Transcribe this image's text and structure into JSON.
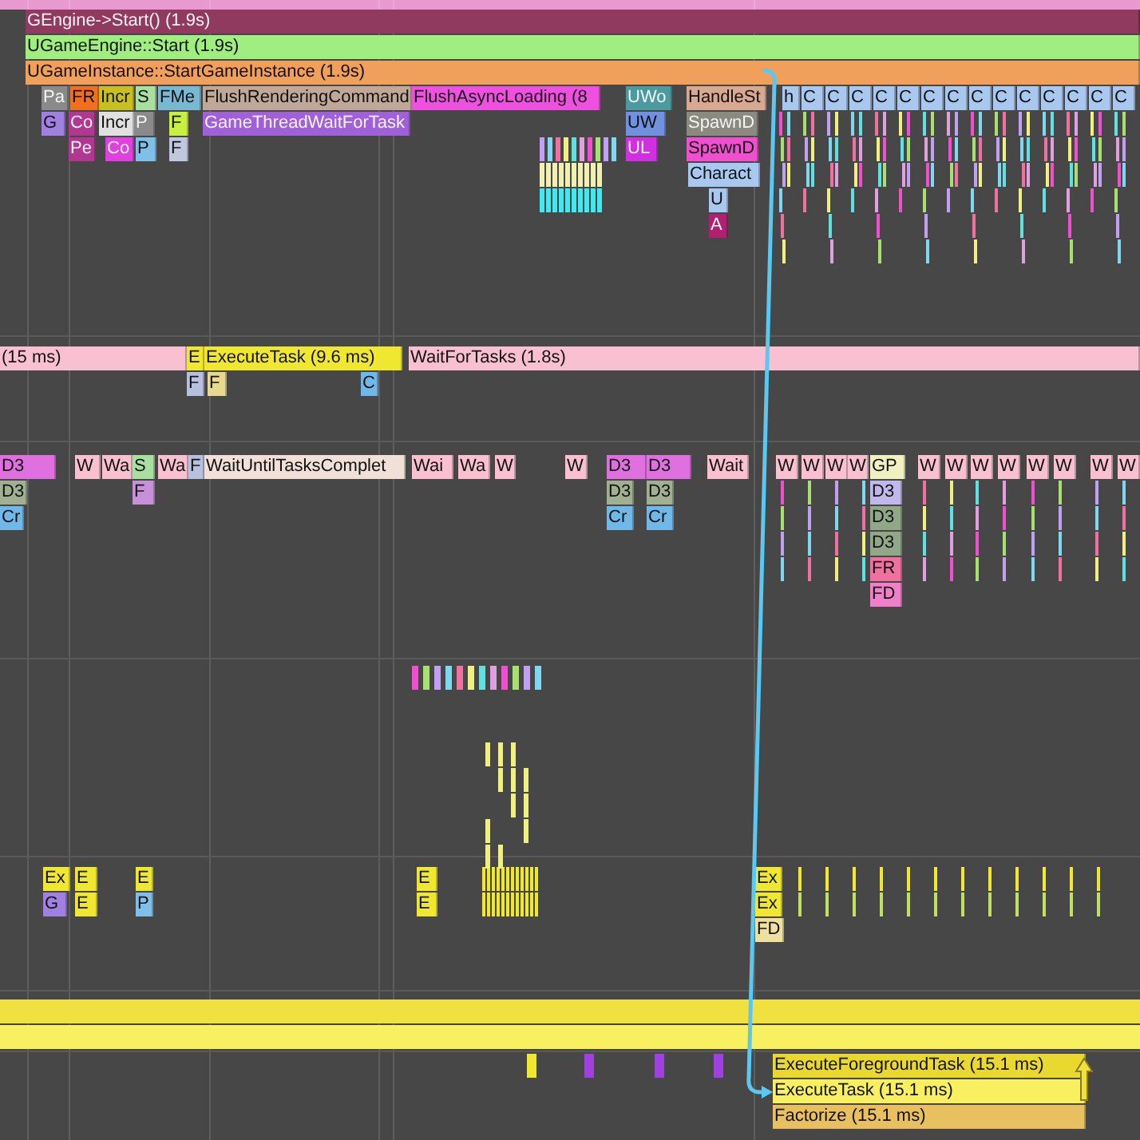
{
  "tracks": [
    {
      "lanes": [
        {
          "events": [
            {
              "label": "GEngine->Start() (1.9s)",
              "color": "#8f3a5e"
            }
          ]
        },
        {
          "events": [
            {
              "label": "UGameEngine::Start (1.9s)",
              "color": "#a0ee80"
            }
          ]
        },
        {
          "events": [
            {
              "label": "UGameInstance::StartGameInstance (1.9s)",
              "color": "#f0a05a"
            }
          ]
        },
        {
          "events": [
            {
              "label": "Pa",
              "color": "#8a8a8a"
            },
            {
              "label": "FR",
              "color": "#f07020"
            },
            {
              "label": "Incr",
              "color": "#c8c020"
            },
            {
              "label": "S",
              "color": "#a8e0a0"
            },
            {
              "label": "FMe",
              "color": "#78b8d0"
            },
            {
              "label": "FlushRenderingCommand",
              "color": "#c0a898"
            },
            {
              "label": "FlushAsyncLoading (8",
              "color": "#f050e0"
            },
            {
              "label": "UWo",
              "color": "#4a9aa0"
            },
            {
              "label": "HandleSt",
              "color": "#d8a890"
            },
            {
              "label": "h",
              "color": "#a8c8f0"
            },
            {
              "label": "C",
              "color": "#a8c8f0"
            },
            {
              "label": "C",
              "color": "#a8c8f0"
            },
            {
              "label": "C",
              "color": "#a8c8f0"
            },
            {
              "label": "C",
              "color": "#a8c8f0"
            },
            {
              "label": "C",
              "color": "#a8c8f0"
            },
            {
              "label": "C",
              "color": "#a8c8f0"
            },
            {
              "label": "C",
              "color": "#a8c8f0"
            },
            {
              "label": "C",
              "color": "#a8c8f0"
            },
            {
              "label": "C",
              "color": "#a8c8f0"
            },
            {
              "label": "C",
              "color": "#a8c8f0"
            },
            {
              "label": "C",
              "color": "#a8c8f0"
            },
            {
              "label": "C",
              "color": "#a8c8f0"
            },
            {
              "label": "C",
              "color": "#a8c8f0"
            },
            {
              "label": "C",
              "color": "#a8c8f0"
            }
          ]
        },
        {
          "events": [
            {
              "label": "G",
              "color": "#a080e0"
            },
            {
              "label": "Co",
              "color": "#b03890"
            },
            {
              "label": "Incr",
              "color": "#e0e0e0"
            },
            {
              "label": "P",
              "color": "#8a8a8a"
            },
            {
              "label": "F",
              "color": "#c8f040"
            },
            {
              "label": "GameThreadWaitForTask",
              "color": "#a060d8"
            },
            {
              "label": "UW",
              "color": "#7090e0"
            },
            {
              "label": "SpawnD",
              "color": "#8a8a80"
            }
          ]
        },
        {
          "events": [
            {
              "label": "Pe",
              "color": "#b03890"
            },
            {
              "label": "Co",
              "color": "#e040e0"
            },
            {
              "label": "P",
              "color": "#80c0e8"
            },
            {
              "label": "F",
              "color": "#c0c8e0"
            },
            {
              "label": "UL",
              "color": "#d030e0"
            },
            {
              "label": "SpawnD",
              "color": "#f050d0"
            }
          ]
        },
        {
          "events": [
            {
              "label": "Charact",
              "color": "#a8c8f0"
            }
          ]
        },
        {
          "events": [
            {
              "label": "U",
              "color": "#a8c8f0"
            }
          ]
        },
        {
          "events": [
            {
              "label": "A",
              "color": "#b02070"
            }
          ]
        }
      ]
    },
    {
      "lanes": [
        {
          "events": [
            {
              "label": "(15 ms)",
              "color": "#f8c0d0"
            },
            {
              "label": "E",
              "color": "#f0e830"
            },
            {
              "label": "ExecuteTask (9.6 ms)",
              "color": "#f0e830"
            },
            {
              "label": "WaitForTasks (1.8s)",
              "color": "#f8c0d0"
            }
          ]
        },
        {
          "events": [
            {
              "label": "F",
              "color": "#b8c0e0"
            },
            {
              "label": "F",
              "color": "#e8d890"
            },
            {
              "label": "C",
              "color": "#70b8e8"
            }
          ]
        }
      ]
    },
    {
      "lanes": [
        {
          "events": [
            {
              "label": "D3",
              "color": "#e070e0"
            },
            {
              "label": "W",
              "color": "#f8c0d0"
            },
            {
              "label": "Wa",
              "color": "#f8c0d0"
            },
            {
              "label": "S",
              "color": "#a8e0a0"
            },
            {
              "label": "Wa",
              "color": "#f8c0d0"
            },
            {
              "label": "F",
              "color": "#b8c0e0"
            },
            {
              "label": "WaitUntilTasksComplet",
              "color": "#f0e0d8"
            },
            {
              "label": "Wai",
              "color": "#f8c0d0"
            },
            {
              "label": "Wa",
              "color": "#f8c0d0"
            },
            {
              "label": "W",
              "color": "#f8c0d0"
            },
            {
              "label": "W",
              "color": "#f8c0d0"
            },
            {
              "label": "D3",
              "color": "#e070e0"
            },
            {
              "label": "D3",
              "color": "#e070e0"
            },
            {
              "label": "Wait",
              "color": "#f8c0d0"
            },
            {
              "label": "W",
              "color": "#f8c0d0"
            },
            {
              "label": "W",
              "color": "#f8c0d0"
            },
            {
              "label": "W",
              "color": "#f8c0d0"
            },
            {
              "label": "W",
              "color": "#f8c0d0"
            },
            {
              "label": "GP",
              "color": "#f0f0c0"
            },
            {
              "label": "W",
              "color": "#f8c0d0"
            },
            {
              "label": "W",
              "color": "#f8c0d0"
            },
            {
              "label": "W",
              "color": "#f8c0d0"
            },
            {
              "label": "W",
              "color": "#f8c0d0"
            },
            {
              "label": "W",
              "color": "#f8c0d0"
            },
            {
              "label": "W",
              "color": "#f8c0d0"
            },
            {
              "label": "W",
              "color": "#f8c0d0"
            },
            {
              "label": "W",
              "color": "#f8c0d0"
            }
          ]
        },
        {
          "events": [
            {
              "label": "D3",
              "color": "#a0b090"
            },
            {
              "label": "F",
              "color": "#c890d8"
            },
            {
              "label": "D3",
              "color": "#a0b090"
            },
            {
              "label": "D3",
              "color": "#a0b090"
            },
            {
              "label": "D3",
              "color": "#c0b8e8"
            }
          ]
        },
        {
          "events": [
            {
              "label": "Cr",
              "color": "#70b8e8"
            },
            {
              "label": "Cr",
              "color": "#70b8e8"
            },
            {
              "label": "Cr",
              "color": "#70b8e8"
            },
            {
              "label": "D3",
              "color": "#90a888"
            }
          ]
        },
        {
          "events": [
            {
              "label": "D3",
              "color": "#90a888"
            }
          ]
        },
        {
          "events": [
            {
              "label": "FR",
              "color": "#f070a0"
            }
          ]
        },
        {
          "events": [
            {
              "label": "FD",
              "color": "#f080c8"
            }
          ]
        }
      ]
    },
    {
      "lanes": [
        {
          "events": [
            {
              "label": "Ex",
              "color": "#f0e830"
            },
            {
              "label": "E",
              "color": "#f0e830"
            },
            {
              "label": "E",
              "color": "#f0e830"
            },
            {
              "label": "E",
              "color": "#f0e830"
            },
            {
              "label": "Ex",
              "color": "#f0e830"
            }
          ]
        },
        {
          "events": [
            {
              "label": "G",
              "color": "#a080e0"
            },
            {
              "label": "E",
              "color": "#f0e830"
            },
            {
              "label": "P",
              "color": "#80c0e8"
            },
            {
              "label": "E",
              "color": "#f0e830"
            },
            {
              "label": "Ex",
              "color": "#f0e830"
            }
          ]
        },
        {
          "events": [
            {
              "label": "FD",
              "color": "#f0e0a0"
            }
          ]
        }
      ]
    },
    {
      "lanes": [
        {
          "events": [
            {
              "label": "ExecuteForegroundTask (15.1 ms)",
              "color": "#e8d830"
            }
          ]
        },
        {
          "events": [
            {
              "label": "ExecuteTask (15.1 ms)",
              "color": "#f8f060"
            }
          ]
        },
        {
          "events": [
            {
              "label": "Factorize (15.1 ms)",
              "color": "#e8c060"
            }
          ]
        }
      ]
    }
  ]
}
